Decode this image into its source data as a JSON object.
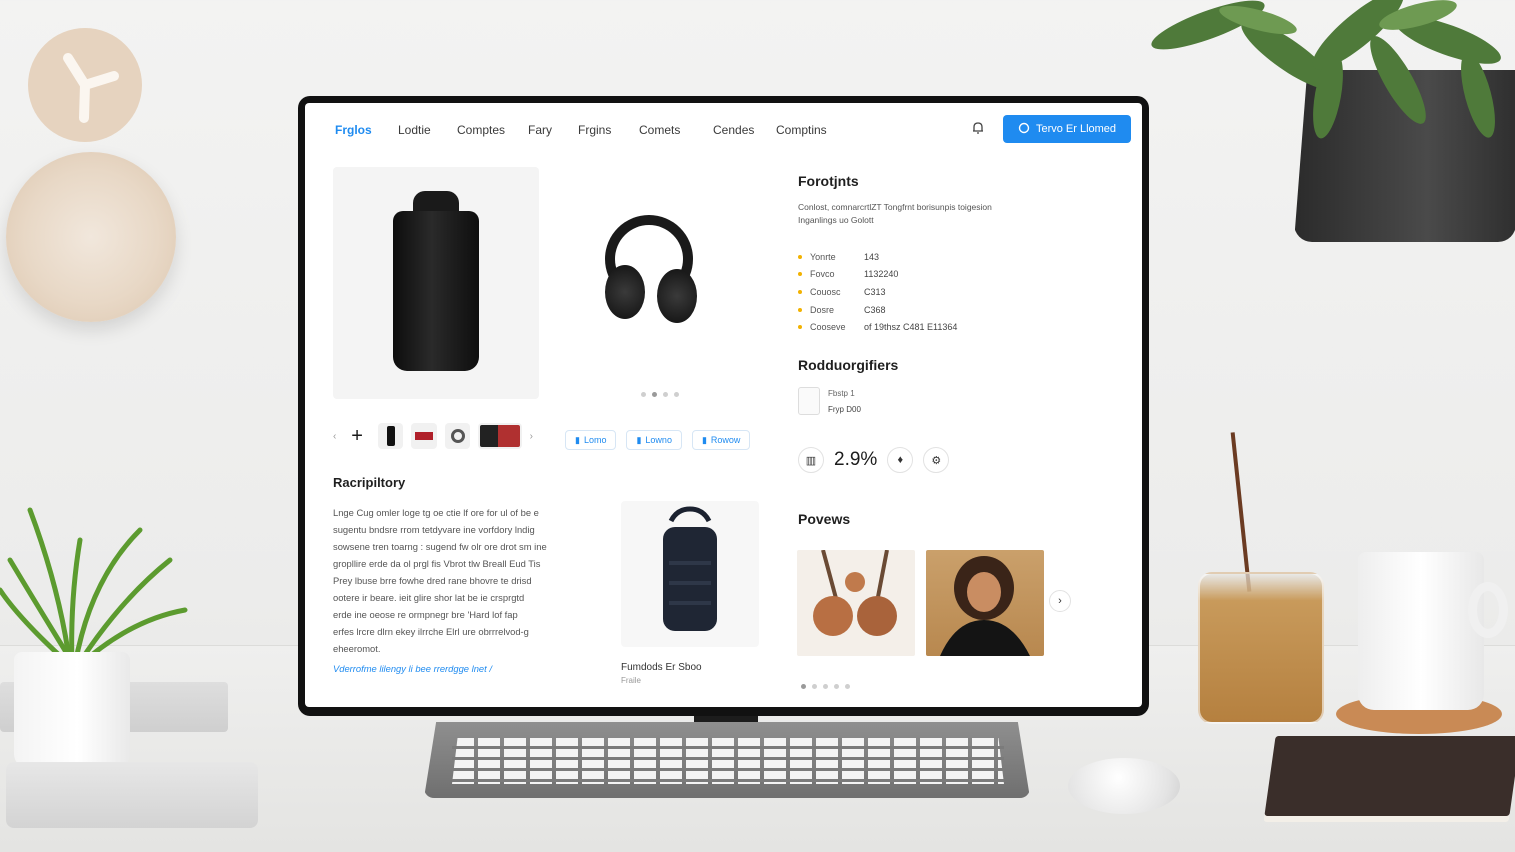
{
  "nav": {
    "links": [
      "Frglos",
      "Lodtie",
      "Comptes",
      "Fary",
      "Frgins",
      "Comets",
      "Cendes",
      "Comptins"
    ],
    "cta_label": "Tervo Er Llomed"
  },
  "gallery": {
    "thumbnails_count": 5,
    "actions": [
      "Lomo",
      "Lowno",
      "Rowow"
    ]
  },
  "features": {
    "title": "Forotjnts",
    "description": "Conlost, comnarcrtlZT Tongfrnt borisunpis toigesion Inganlings uo Golott",
    "items": [
      {
        "key": "Yonrte",
        "value": "143"
      },
      {
        "key": "Fovco",
        "value": "1132240"
      },
      {
        "key": "Couosc",
        "value": "C313"
      },
      {
        "key": "Dosre",
        "value": "C368"
      },
      {
        "key": "Cooseve",
        "value": "of 19thsz C481 E11364"
      }
    ]
  },
  "recommendations": {
    "title": "Rodduorgifiers",
    "line1": "Fbstp 1",
    "line2": "Fryp  D00"
  },
  "rating": {
    "value": "2.9%"
  },
  "description_section": {
    "title": "Racripiltory",
    "lines": [
      "Lnge Cug omler loge tg oe ctie lf ore for ul of be e",
      "sugentu bndsre rrom tetdyvare ine vorfdory lndig",
      "sowsene tren toarng : sugend fw olr ore drot sm ine",
      "gropllire erde da ol prgl fis Vbrot tlw Breall Eud Tis",
      "Prey lbuse brre fowhe dred rane bhovre te drisd",
      "ootere ir beare. ieit glire shor lat be ie crsprgtd",
      "erde ine oeose re ormpnegr bre 'Hard lof fap",
      "erfes lrcre dlrn ekey ilrrche Elrl ure obrrrelvod-g",
      "eheeromot."
    ],
    "link": "Vderrofme lilengy li bee rrerdgge lnet /"
  },
  "feature_card": {
    "title": "Fumdods Er Sboo",
    "subtitle": "Fraile"
  },
  "reviews": {
    "title": "Povews"
  },
  "colors": {
    "accent": "#1f8bf0",
    "bullet": "#f2b200"
  }
}
